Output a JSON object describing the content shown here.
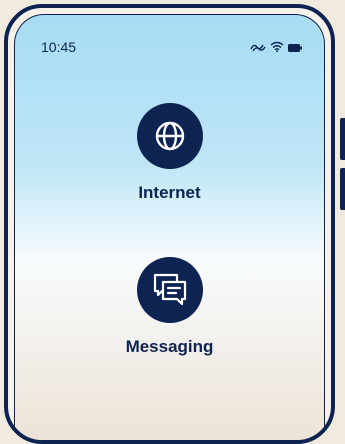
{
  "status_bar": {
    "time": "10:45",
    "icons": [
      "signal-icon",
      "wifi-icon",
      "battery-icon"
    ]
  },
  "apps": [
    {
      "label": "Internet",
      "icon": "globe-icon"
    },
    {
      "label": "Messaging",
      "icon": "chat-bubbles-icon"
    }
  ],
  "colors": {
    "navy": "#0d2352",
    "sky": "#a6dcf4",
    "cream": "#ece3d7"
  }
}
